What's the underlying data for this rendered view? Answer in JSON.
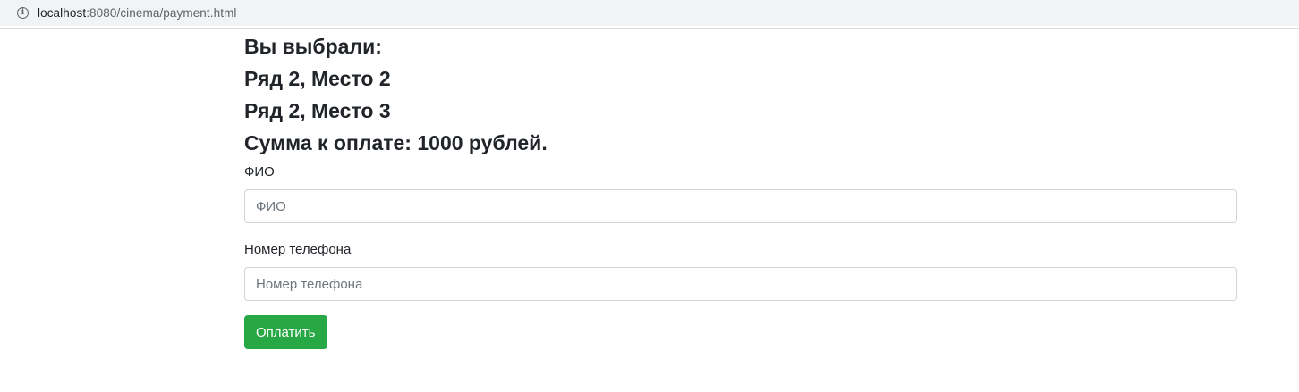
{
  "browser": {
    "url_host": "localhost",
    "url_rest": ":8080/cinema/payment.html",
    "info_icon": "info-icon"
  },
  "summary": {
    "title": "Вы выбрали:",
    "seats": [
      "Ряд 2, Место 2",
      "Ряд 2, Место 3"
    ],
    "total": "Сумма к оплате: 1000 рублей."
  },
  "form": {
    "name_label": "ФИО",
    "name_placeholder": "ФИО",
    "name_value": "",
    "phone_label": "Номер телефона",
    "phone_placeholder": "Номер телефона",
    "phone_value": "",
    "submit_label": "Оплатить"
  },
  "colors": {
    "button": "#28a745",
    "text": "#212529",
    "input_border": "#ced4da"
  }
}
